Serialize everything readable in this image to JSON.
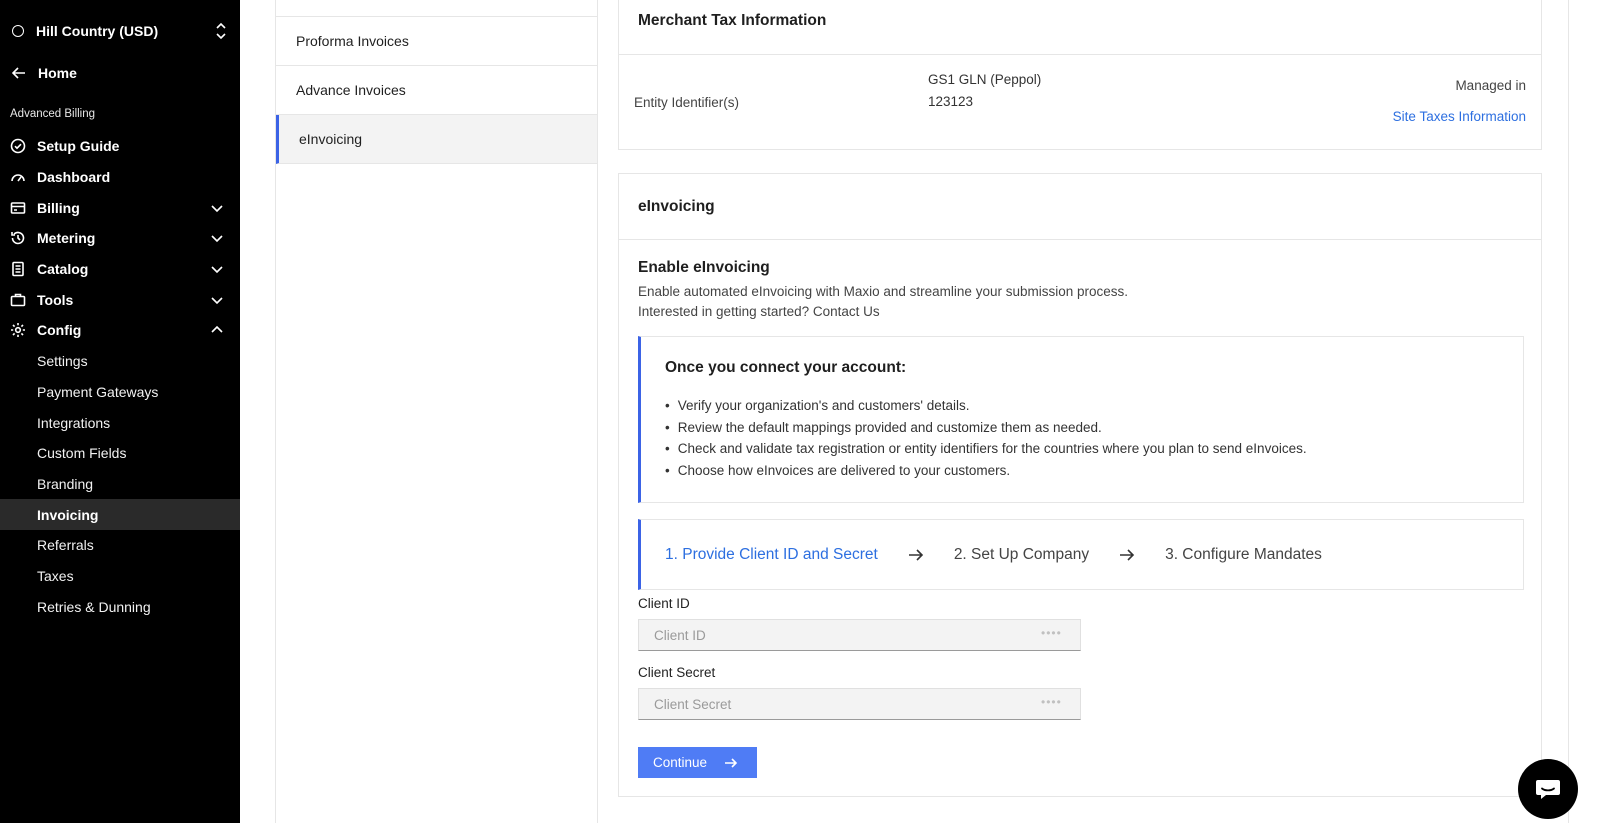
{
  "sidebar": {
    "site_name": "Hill Country (USD)",
    "home_label": "Home",
    "section_label": "Advanced Billing",
    "items": [
      {
        "label": "Setup Guide",
        "icon": "check-circle-icon",
        "expandable": false
      },
      {
        "label": "Dashboard",
        "icon": "gauge-icon",
        "expandable": false
      },
      {
        "label": "Billing",
        "icon": "card-icon",
        "expandable": true,
        "expanded": false
      },
      {
        "label": "Metering",
        "icon": "history-icon",
        "expandable": true,
        "expanded": false
      },
      {
        "label": "Catalog",
        "icon": "document-icon",
        "expandable": true,
        "expanded": false
      },
      {
        "label": "Tools",
        "icon": "briefcase-icon",
        "expandable": true,
        "expanded": false
      },
      {
        "label": "Config",
        "icon": "gear-icon",
        "expandable": true,
        "expanded": true
      }
    ],
    "config_sub_items": [
      "Settings",
      "Payment Gateways",
      "Integrations",
      "Custom Fields",
      "Branding",
      "Invoicing",
      "Referrals",
      "Taxes",
      "Retries & Dunning"
    ],
    "active_sub_item": "Invoicing"
  },
  "submenu": {
    "items": [
      "Proforma Invoices",
      "Advance Invoices",
      "eInvoicing"
    ],
    "active": "eInvoicing"
  },
  "merchant_tax": {
    "title": "Merchant Tax Information",
    "entity_label": "Entity Identifier(s)",
    "entity_type": "GS1 GLN (Peppol)",
    "entity_value": "123123",
    "managed_in": "Managed in",
    "link": "Site Taxes Information"
  },
  "einvoicing": {
    "title": "eInvoicing",
    "enable_title": "Enable eInvoicing",
    "desc1": "Enable automated eInvoicing with Maxio and streamline your submission process.",
    "desc2": "Interested in getting started? Contact Us",
    "info_title": "Once you connect your account:",
    "info_items": [
      "Verify your organization's and customers' details.",
      "Review the default mappings provided and customize them as needed.",
      "Check and validate tax registration or entity identifiers for the countries where you plan to send eInvoices.",
      "Choose how eInvoices are delivered to your customers."
    ],
    "steps": [
      "1. Provide Client ID and Secret",
      "2. Set Up Company",
      "3. Configure Mandates"
    ],
    "active_step": 0,
    "client_id_label": "Client ID",
    "client_id_placeholder": "Client ID",
    "client_id_value": "",
    "client_secret_label": "Client Secret",
    "client_secret_placeholder": "Client Secret",
    "client_secret_value": "",
    "continue_label": "Continue"
  },
  "colors": {
    "accent": "#3b63e6",
    "link": "#2d6fe0",
    "button": "#4f7cf5",
    "sidebar_bg": "#000000"
  }
}
